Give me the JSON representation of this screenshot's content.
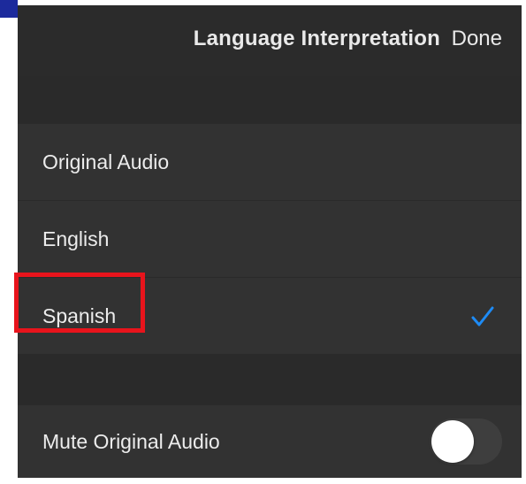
{
  "header": {
    "title": "Language Interpretation",
    "done_label": "Done"
  },
  "languages": {
    "items": [
      {
        "label": "Original Audio",
        "selected": false
      },
      {
        "label": "English",
        "selected": false
      },
      {
        "label": "Spanish",
        "selected": true
      }
    ],
    "check_icon": "checkmark-icon",
    "check_color": "#1e8bf5"
  },
  "mute": {
    "label": "Mute Original Audio",
    "enabled": false
  },
  "highlight": {
    "color": "#e8141c",
    "target": "Spanish"
  }
}
